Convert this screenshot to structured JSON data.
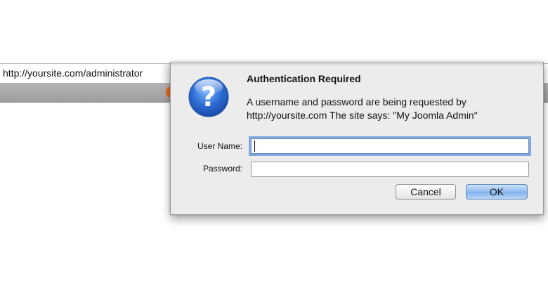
{
  "browser": {
    "url": "http://yoursite.com/administrator"
  },
  "dialog": {
    "title": "Authentication Required",
    "message_line1": "A username and password are being requested by",
    "message_line2": "http://yoursite.com The site says: \"My Joomla Admin\"",
    "icon": "question-mark-icon",
    "fields": {
      "username_label": "User Name:",
      "username_value": "",
      "password_label": "Password:",
      "password_value": ""
    },
    "buttons": {
      "cancel_label": "Cancel",
      "ok_label": "OK"
    }
  },
  "colors": {
    "icon_blue": "#2f6fd6",
    "focus_ring": "#7fa8dd",
    "default_button": "#8fbcf0"
  }
}
